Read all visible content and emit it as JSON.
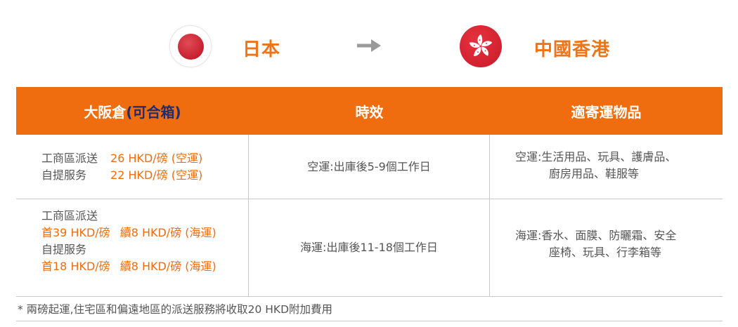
{
  "route": {
    "from_flag_icon": "japan-flag-icon",
    "from_country": "日本",
    "arrow_icon": "arrow-right-icon",
    "to_flag_icon": "hong-kong-flag-icon",
    "to_country": "中國香港"
  },
  "colors": {
    "accent": "#ef6c0f",
    "header_paren": "#1f2d6b",
    "text": "#555555",
    "border": "#c9c9c9"
  },
  "table": {
    "headers": {
      "warehouse": "大阪倉",
      "warehouse_note": "(可合箱)",
      "timing": "時效",
      "goods": "適寄運物品"
    },
    "rows": [
      {
        "pricing": {
          "line1_label": "工商區派送",
          "line1_price": "26 HKD/磅 (空運)",
          "line2_label": "自提服务",
          "line2_price": "22 HKD/磅 (空運)"
        },
        "timing": "空運:出庫後5-9個工作日",
        "goods_line1": "空運:生活用品、玩具、護膚品、",
        "goods_line2": "廚房用品、鞋服等"
      },
      {
        "pricing": {
          "line1_label": "工商區派送",
          "line2_first": "首39 HKD/磅",
          "line2_cont": "續8 HKD/磅 (海運)",
          "line3_label": "自提服务",
          "line4_first": "首18 HKD/磅",
          "line4_cont": "續8 HKD/磅 (海運)"
        },
        "timing": "海運:出庫後11-18個工作日",
        "goods_line1": "海運:香水、面膜、防曬霜、安全",
        "goods_line2": "座椅、玩具、行李箱等"
      }
    ]
  },
  "footnote": "* 兩磅起運,住宅區和偏遠地區的派送服務將收取20 HKD附加費用"
}
